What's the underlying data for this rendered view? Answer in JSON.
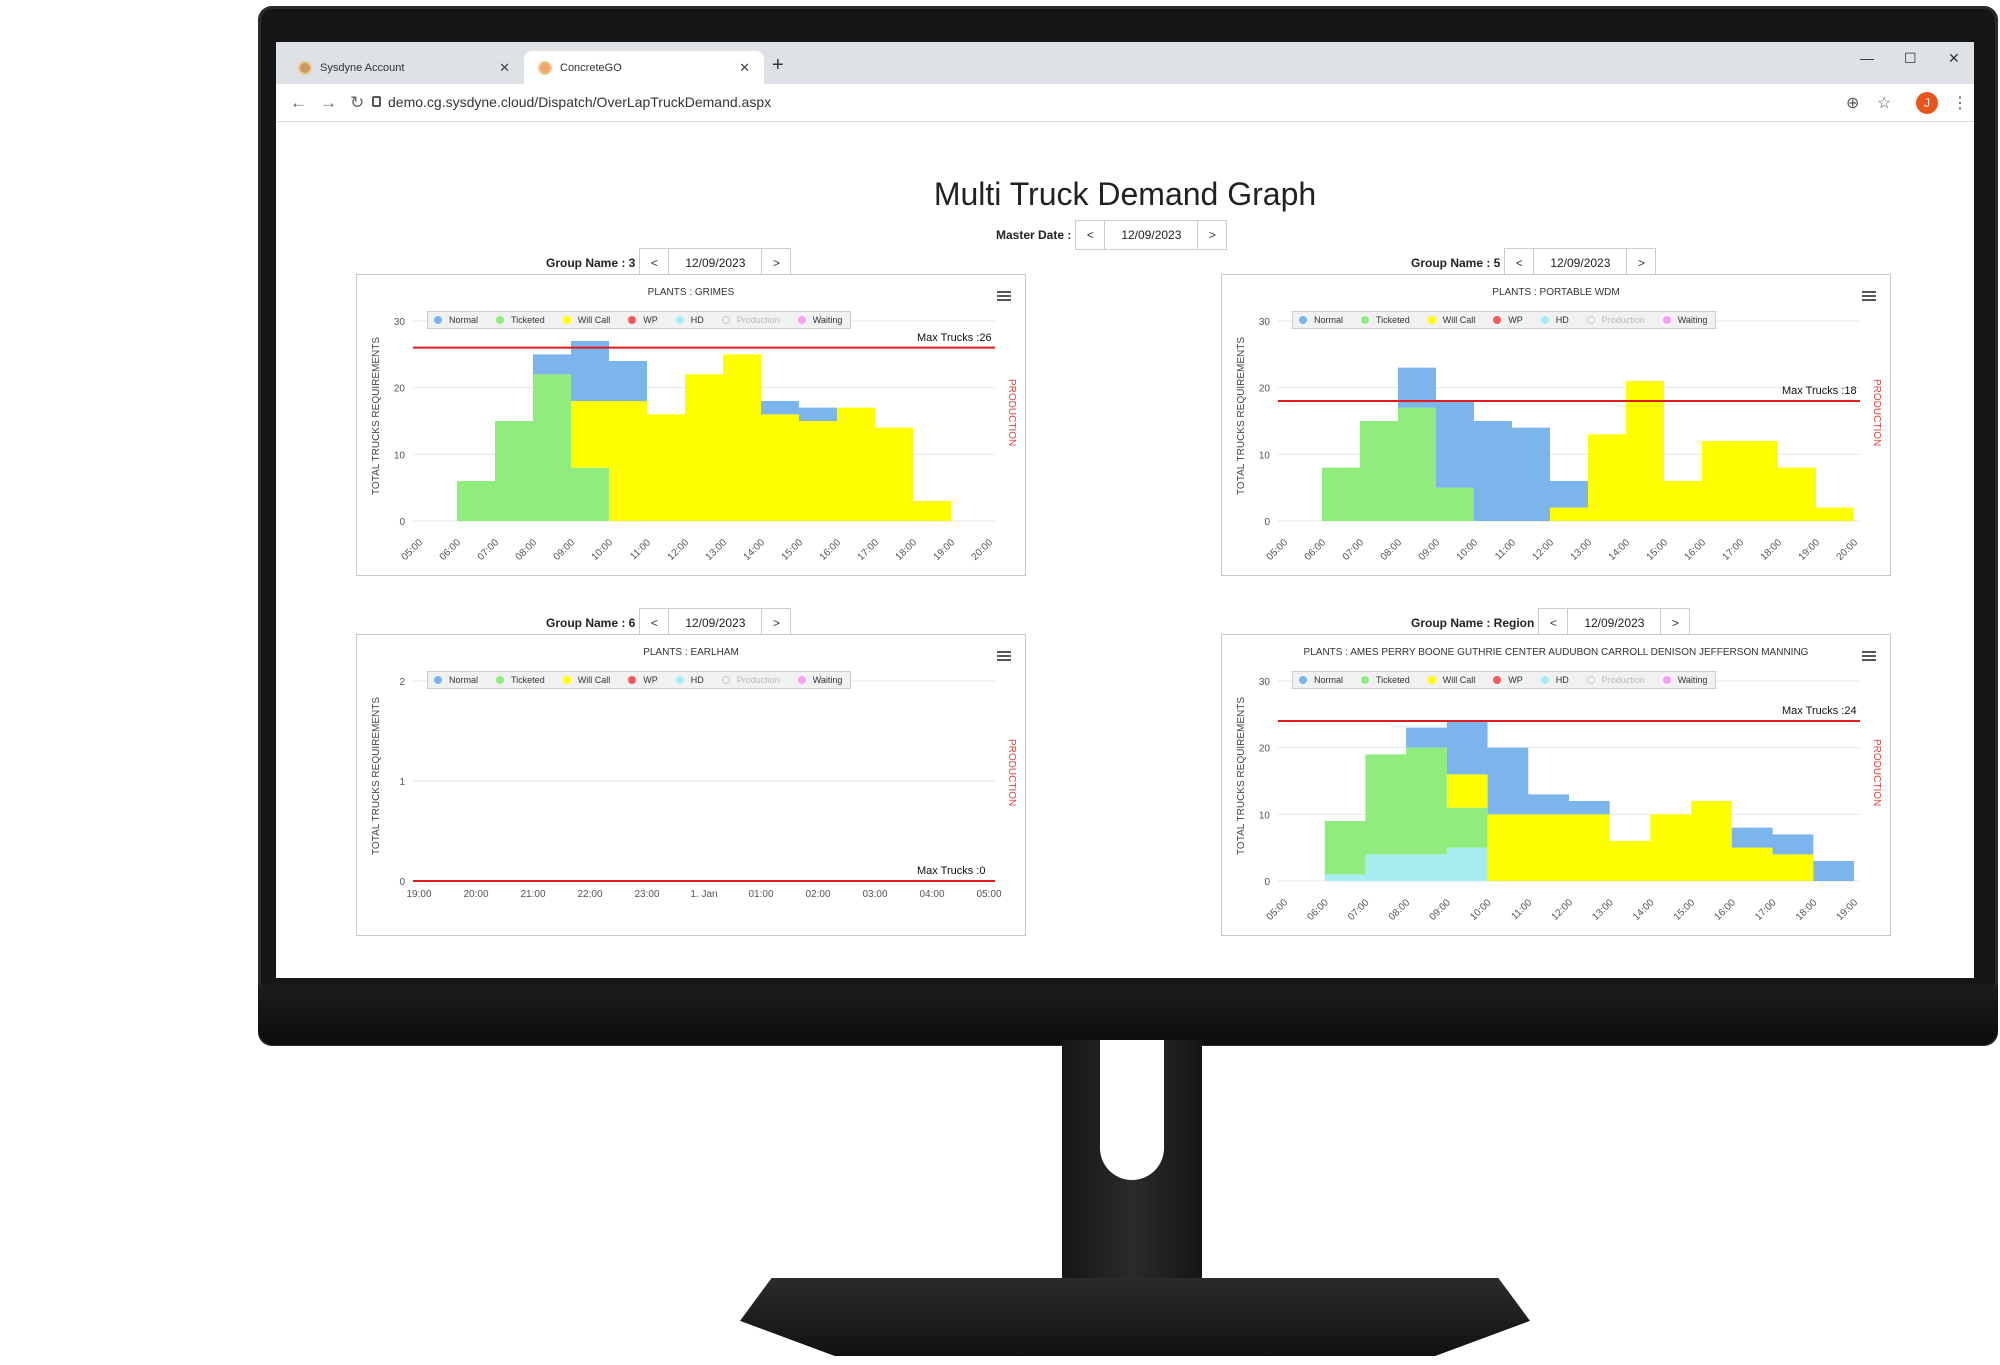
{
  "browser": {
    "tabs": [
      {
        "label": "Sysdyne Account"
      },
      {
        "label": "ConcreteGO"
      }
    ],
    "url": "demo.cg.sysdyne.cloud/Dispatch/OverLapTruckDemand.aspx",
    "profile_initial": "J"
  },
  "page": {
    "title": "Multi Truck Demand Graph",
    "master": {
      "label": "Master Date :",
      "date": "12/09/2023",
      "prev": "<",
      "next": ">"
    }
  },
  "legend": [
    {
      "label": "Normal",
      "color": "#7cb5ec"
    },
    {
      "label": "Ticketed",
      "color": "#90ed7d"
    },
    {
      "label": "Will Call",
      "color": "#ffff00"
    },
    {
      "label": "WP",
      "color": "#f45b5b"
    },
    {
      "label": "HD",
      "color": "#a8ecf0"
    },
    {
      "label": "Production",
      "color": "#cccccc"
    },
    {
      "label": "Waiting",
      "color": "#f7a0f0"
    }
  ],
  "y_axis_label": "TOTAL TRUCKS REQUIREMENTS",
  "production_label": "PRODUCTION",
  "chart_data": [
    {
      "type": "area",
      "group_label": "Group Name : 3",
      "date": "12/09/2023",
      "title": "PLANTS : GRIMES",
      "max_label": "Max Trucks :26",
      "max": 26,
      "ylim": [
        0,
        30
      ],
      "yticks": [
        "0",
        "10",
        "20",
        "30"
      ],
      "x": [
        "05:00",
        "06:00",
        "07:00",
        "08:00",
        "09:00",
        "10:00",
        "11:00",
        "12:00",
        "13:00",
        "14:00",
        "15:00",
        "16:00",
        "17:00",
        "18:00",
        "19:00",
        "20:00"
      ],
      "series": [
        {
          "name": "Ticketed",
          "values": [
            0,
            6,
            15,
            22,
            8,
            0,
            0,
            0,
            0,
            0,
            0,
            0,
            0,
            0,
            0,
            0
          ]
        },
        {
          "name": "Will Call",
          "values": [
            0,
            0,
            0,
            0,
            10,
            18,
            16,
            22,
            25,
            16,
            15,
            17,
            14,
            3,
            0,
            0
          ]
        },
        {
          "name": "Normal",
          "values": [
            0,
            0,
            0,
            3,
            9,
            6,
            0,
            0,
            0,
            2,
            2,
            0,
            0,
            0,
            0,
            0
          ]
        }
      ]
    },
    {
      "type": "area",
      "group_label": "Group Name : 5",
      "date": "12/09/2023",
      "title": "PLANTS : PORTABLE WDM",
      "max_label": "Max Trucks :18",
      "max": 18,
      "ylim": [
        0,
        30
      ],
      "yticks": [
        "0",
        "10",
        "20",
        "30"
      ],
      "x": [
        "05:00",
        "06:00",
        "07:00",
        "08:00",
        "09:00",
        "10:00",
        "11:00",
        "12:00",
        "13:00",
        "14:00",
        "15:00",
        "16:00",
        "17:00",
        "18:00",
        "19:00",
        "20:00"
      ],
      "series": [
        {
          "name": "Ticketed",
          "values": [
            0,
            8,
            15,
            17,
            5,
            0,
            0,
            0,
            0,
            0,
            0,
            0,
            0,
            0,
            0,
            0
          ]
        },
        {
          "name": "Will Call",
          "values": [
            0,
            0,
            0,
            0,
            0,
            0,
            0,
            2,
            13,
            21,
            6,
            12,
            12,
            8,
            2,
            0
          ]
        },
        {
          "name": "Normal",
          "values": [
            0,
            0,
            0,
            6,
            13,
            15,
            14,
            4,
            0,
            0,
            0,
            0,
            0,
            0,
            0,
            0
          ]
        }
      ]
    },
    {
      "type": "area",
      "group_label": "Group Name : 6",
      "date": "12/09/2023",
      "title": "PLANTS : EARLHAM",
      "max_label": "Max Trucks :0",
      "max": 0,
      "ylim": [
        0,
        2
      ],
      "yticks": [
        "0",
        "1",
        "2"
      ],
      "x": [
        "19:00",
        "20:00",
        "21:00",
        "22:00",
        "23:00",
        "1. Jan",
        "01:00",
        "02:00",
        "03:00",
        "04:00",
        "05:00"
      ],
      "series": []
    },
    {
      "type": "area",
      "group_label": "Group Name : Region",
      "date": "12/09/2023",
      "title": "PLANTS : AMES PERRY BOONE GUTHRIE CENTER AUDUBON CARROLL DENISON JEFFERSON MANNING",
      "max_label": "Max Trucks :24",
      "max": 24,
      "ylim": [
        0,
        30
      ],
      "yticks": [
        "0",
        "10",
        "20",
        "30"
      ],
      "x": [
        "05:00",
        "06:00",
        "07:00",
        "08:00",
        "09:00",
        "10:00",
        "11:00",
        "12:00",
        "13:00",
        "14:00",
        "15:00",
        "16:00",
        "17:00",
        "18:00",
        "19:00"
      ],
      "series": [
        {
          "name": "HD",
          "values": [
            0,
            1,
            4,
            4,
            5,
            0,
            0,
            0,
            0,
            0,
            0,
            0,
            0,
            0,
            0
          ]
        },
        {
          "name": "Ticketed",
          "values": [
            0,
            8,
            15,
            16,
            6,
            0,
            0,
            0,
            0,
            0,
            0,
            0,
            0,
            0,
            0
          ]
        },
        {
          "name": "Will Call",
          "values": [
            0,
            0,
            0,
            0,
            5,
            10,
            10,
            10,
            6,
            10,
            12,
            5,
            4,
            0,
            0
          ]
        },
        {
          "name": "Normal",
          "values": [
            0,
            0,
            0,
            3,
            8,
            10,
            3,
            2,
            0,
            0,
            0,
            3,
            3,
            3,
            0
          ]
        }
      ]
    }
  ]
}
